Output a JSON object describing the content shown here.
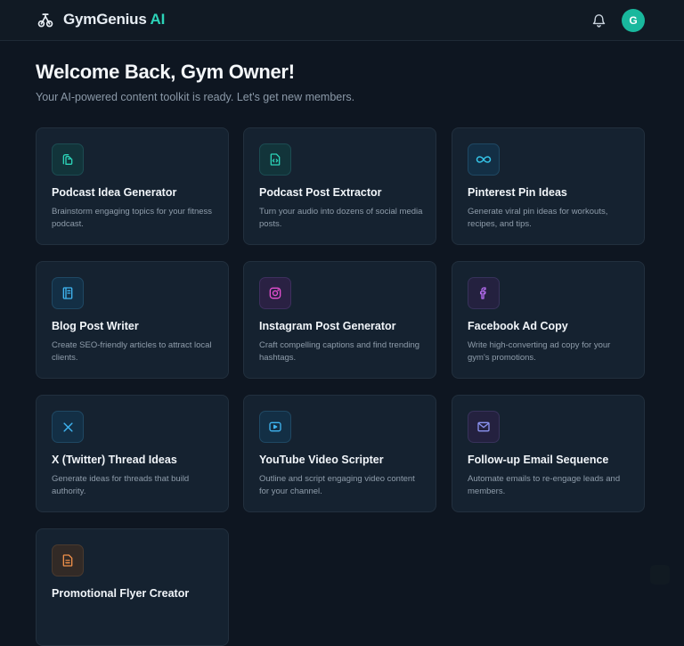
{
  "header": {
    "brand_name": "GymGenius",
    "brand_suffix": "AI",
    "logo_icon": "barbell-dumbbell-icon",
    "notification_icon": "bell-icon",
    "avatar_initial": "G"
  },
  "welcome": {
    "title": "Welcome Back, Gym Owner!",
    "subtitle": "Your AI-powered content toolkit is ready. Let's get new members."
  },
  "tools": [
    {
      "title": "Podcast Idea Generator",
      "desc": "Brainstorm engaging topics for your fitness podcast.",
      "icon": "podcast-idea-icon",
      "accent": "#2cd3b8"
    },
    {
      "title": "Podcast Post Extractor",
      "desc": "Turn your audio into dozens of social media posts.",
      "icon": "file-code-icon",
      "accent": "#2cd3b8"
    },
    {
      "title": "Pinterest Pin Ideas",
      "desc": "Generate viral pin ideas for workouts, recipes, and tips.",
      "icon": "infinity-icon",
      "accent": "#35c4e8"
    },
    {
      "title": "Blog Post Writer",
      "desc": "Create SEO-friendly articles to attract local clients.",
      "icon": "book-icon",
      "accent": "#3fb4f0"
    },
    {
      "title": "Instagram Post Generator",
      "desc": "Craft compelling captions and find trending hashtags.",
      "icon": "instagram-icon",
      "accent": "#e44fd0"
    },
    {
      "title": "Facebook Ad Copy",
      "desc": "Write high-converting ad copy for your gym's promotions.",
      "icon": "facebook-icon",
      "accent": "#b56cf0"
    },
    {
      "title": "X (Twitter) Thread Ideas",
      "desc": "Generate ideas for threads that build authority.",
      "icon": "x-icon",
      "accent": "#3fb4f0"
    },
    {
      "title": "YouTube Video Scripter",
      "desc": "Outline and script engaging video content for your channel.",
      "icon": "video-icon",
      "accent": "#3fb4f0"
    },
    {
      "title": "Follow-up Email Sequence",
      "desc": "Automate emails to re-engage leads and members.",
      "icon": "mail-icon",
      "accent": "#8b93f0"
    },
    {
      "title": "Promotional Flyer Creator",
      "desc": "",
      "icon": "document-icon",
      "accent": "#f0904a"
    }
  ]
}
